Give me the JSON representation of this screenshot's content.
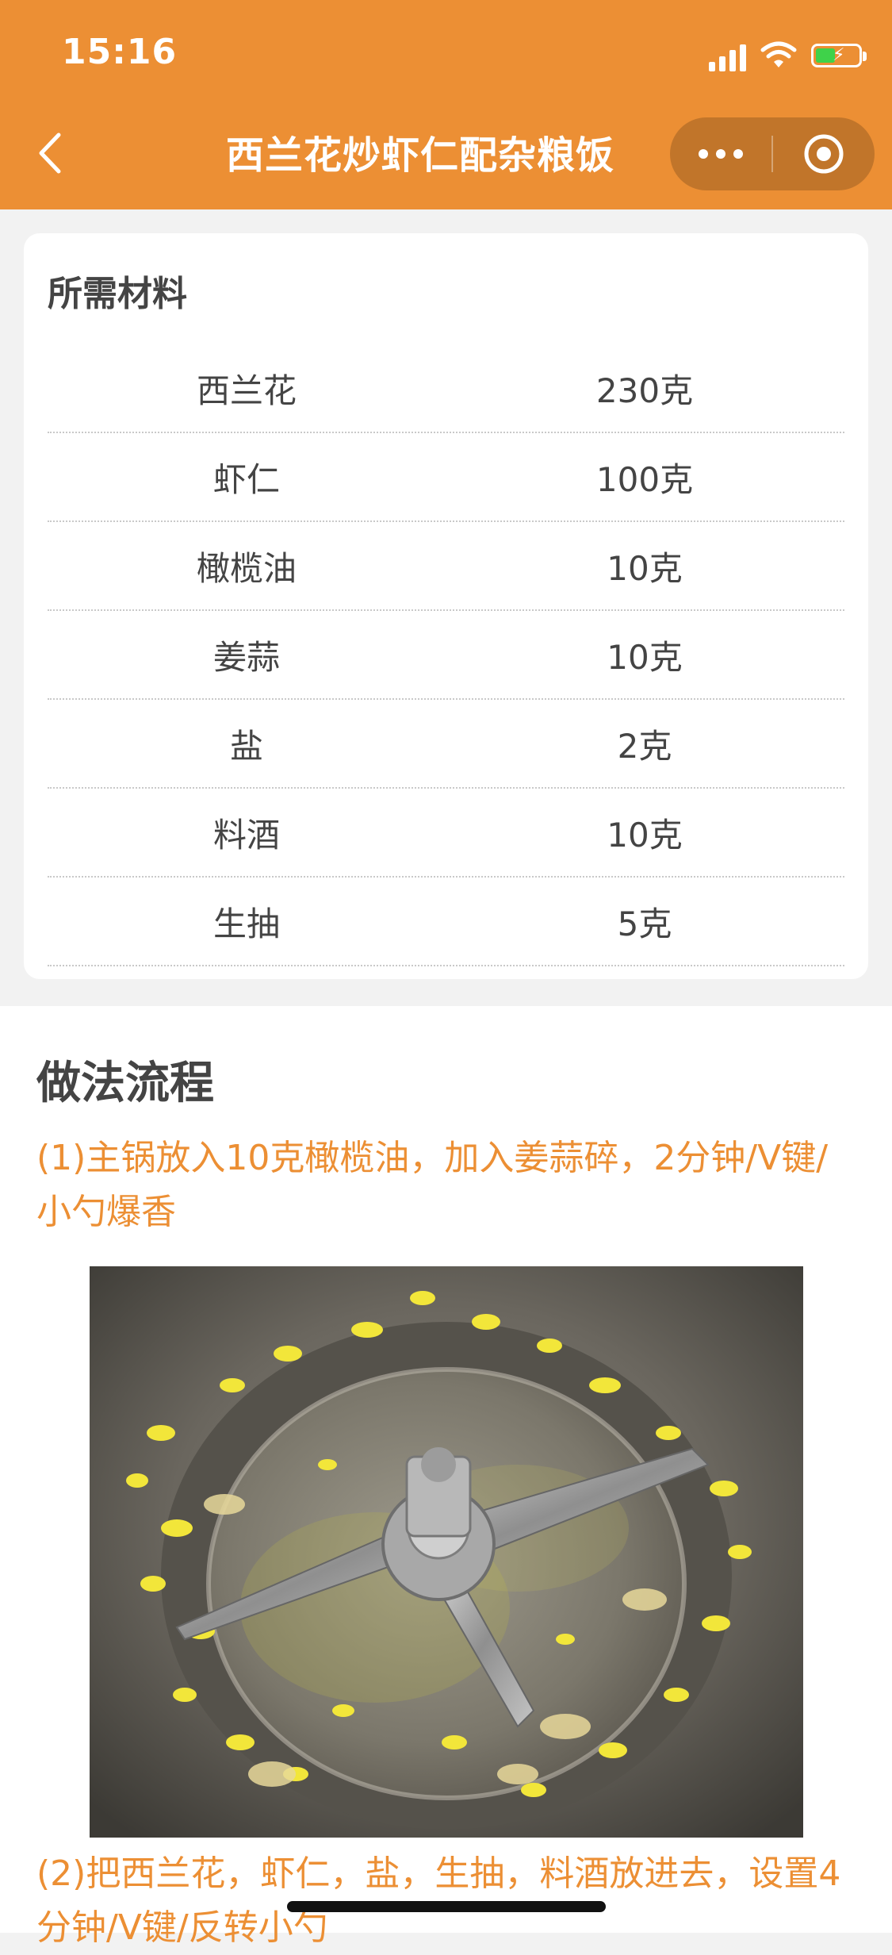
{
  "status": {
    "time": "15:16"
  },
  "nav": {
    "title": "西兰花炒虾仁配杂粮饭"
  },
  "ingredients": {
    "heading": "所需材料",
    "items": [
      {
        "name": "西兰花",
        "qty": "230克"
      },
      {
        "name": "虾仁",
        "qty": "100克"
      },
      {
        "name": "橄榄油",
        "qty": "10克"
      },
      {
        "name": "姜蒜",
        "qty": "10克"
      },
      {
        "name": "盐",
        "qty": "2克"
      },
      {
        "name": "料酒",
        "qty": "10克"
      },
      {
        "name": "生抽",
        "qty": "5克"
      }
    ]
  },
  "steps": {
    "heading": "做法流程",
    "items": [
      {
        "text": "(1)主锅放入10克橄榄油，加入姜蒜碎，2分钟/V键/小勺爆香"
      },
      {
        "text": "(2)把西兰花，虾仁，盐，生抽，料酒放进去，设置4分钟/V键/反转小勺"
      }
    ]
  },
  "colors": {
    "accent": "#ec8f34",
    "battery": "#3fd24a"
  }
}
